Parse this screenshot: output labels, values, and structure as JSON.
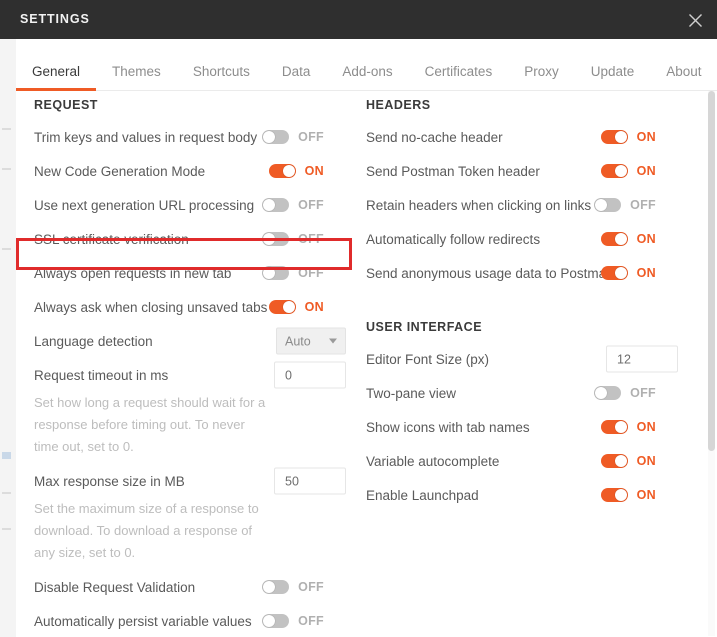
{
  "window": {
    "title": "SETTINGS",
    "close_icon": "close-icon"
  },
  "tabs": [
    {
      "label": "General",
      "active": true
    },
    {
      "label": "Themes",
      "active": false
    },
    {
      "label": "Shortcuts",
      "active": false
    },
    {
      "label": "Data",
      "active": false
    },
    {
      "label": "Add-ons",
      "active": false
    },
    {
      "label": "Certificates",
      "active": false
    },
    {
      "label": "Proxy",
      "active": false
    },
    {
      "label": "Update",
      "active": false
    },
    {
      "label": "About",
      "active": false
    }
  ],
  "colors": {
    "accent": "#ef5b25",
    "titlebar": "#2f2f2f",
    "highlight": "#e02b2b",
    "toggle_off": "#c2c2c2",
    "label": "#5a5a5a",
    "description": "#bdbdbd"
  },
  "left_column": {
    "section": "REQUEST",
    "rows": [
      {
        "label": "Trim keys and values in request body",
        "type": "toggle",
        "value": "OFF",
        "on": false
      },
      {
        "label": "New Code Generation Mode",
        "type": "toggle",
        "value": "ON",
        "on": true
      },
      {
        "label": "Use next generation URL processing",
        "type": "toggle",
        "value": "OFF",
        "on": false
      },
      {
        "label": "SSL certificate verification",
        "type": "toggle",
        "value": "OFF",
        "on": false,
        "highlighted": true
      },
      {
        "label": "Always open requests in new tab",
        "type": "toggle",
        "value": "OFF",
        "on": false
      },
      {
        "label": "Always ask when closing unsaved tabs",
        "type": "toggle",
        "value": "ON",
        "on": true
      },
      {
        "label": "Language detection",
        "type": "select",
        "value": "Auto"
      },
      {
        "label": "Request timeout in ms",
        "type": "input",
        "value": "0",
        "description": "Set how long a request should wait for a response before timing out. To never time out, set to 0."
      },
      {
        "label": "Max response size in MB",
        "type": "input",
        "value": "50",
        "description": "Set the maximum size of a response to download. To download a response of any size, set to 0."
      },
      {
        "label": "Disable Request Validation",
        "type": "toggle",
        "value": "OFF",
        "on": false
      },
      {
        "label": "Automatically persist variable values",
        "type": "toggle",
        "value": "OFF",
        "on": false
      }
    ]
  },
  "right_column": {
    "sections": [
      {
        "section": "HEADERS",
        "rows": [
          {
            "label": "Send no-cache header",
            "type": "toggle",
            "value": "ON",
            "on": true
          },
          {
            "label": "Send Postman Token header",
            "type": "toggle",
            "value": "ON",
            "on": true
          },
          {
            "label": "Retain headers when clicking on links",
            "type": "toggle",
            "value": "OFF",
            "on": false
          },
          {
            "label": "Automatically follow redirects",
            "type": "toggle",
            "value": "ON",
            "on": true
          },
          {
            "label": "Send anonymous usage data to Postman",
            "type": "toggle",
            "value": "ON",
            "on": true
          }
        ]
      },
      {
        "section": "USER INTERFACE",
        "rows": [
          {
            "label": "Editor Font Size (px)",
            "type": "input",
            "value": "12"
          },
          {
            "label": "Two-pane view",
            "type": "toggle",
            "value": "OFF",
            "on": false
          },
          {
            "label": "Show icons with tab names",
            "type": "toggle",
            "value": "ON",
            "on": true
          },
          {
            "label": "Variable autocomplete",
            "type": "toggle",
            "value": "ON",
            "on": true
          },
          {
            "label": "Enable Launchpad",
            "type": "toggle",
            "value": "ON",
            "on": true
          }
        ]
      }
    ]
  }
}
